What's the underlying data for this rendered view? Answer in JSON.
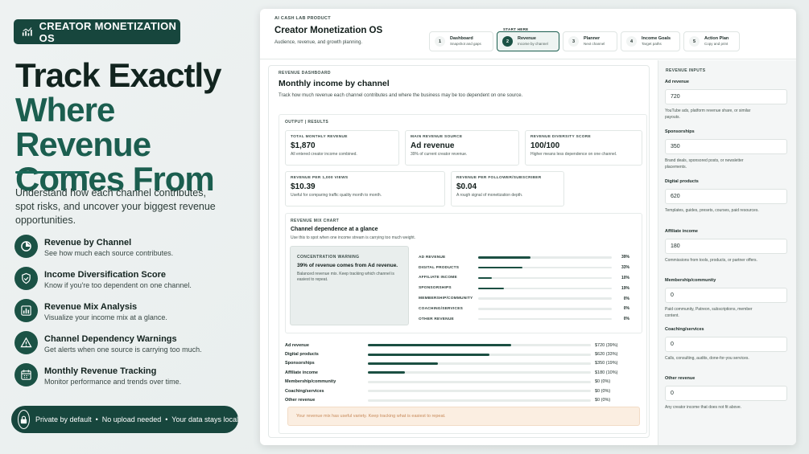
{
  "brand": {
    "label": "CREATOR MONETIZATION OS"
  },
  "hero": {
    "line1": "Track Exactly",
    "line2": "Where Revenue",
    "line3": "Comes From",
    "subtitle": "Understand how each channel contributes, spot risks, and uncover your biggest revenue opportunities."
  },
  "features": [
    {
      "title": "Revenue by Channel",
      "desc": "See how much each source contributes.",
      "icon": "pie-chart-icon"
    },
    {
      "title": "Income Diversification Score",
      "desc": "Know if you're too dependent on one channel.",
      "icon": "shield-check-icon"
    },
    {
      "title": "Revenue Mix Analysis",
      "desc": "Visualize your income mix at a glance.",
      "icon": "bar-chart-icon"
    },
    {
      "title": "Channel Dependency Warnings",
      "desc": "Get alerts when one source is carrying too much.",
      "icon": "warning-icon"
    },
    {
      "title": "Monthly Revenue Tracking",
      "desc": "Monitor performance and trends over time.",
      "icon": "calendar-icon"
    }
  ],
  "privacy": {
    "text": "Private by default  •  No upload needed  •  Your data stays local"
  },
  "app": {
    "kicker": "AI CASH LAB PRODUCT",
    "title": "Creator Monetization OS",
    "subtitle": "Audience, revenue, and growth planning.",
    "start_here": "START HERE",
    "steps": [
      {
        "num": "1",
        "label": "Dashboard",
        "sub": "Snapshot and gaps"
      },
      {
        "num": "2",
        "label": "Revenue",
        "sub": "Income by channel"
      },
      {
        "num": "3",
        "label": "Planner",
        "sub": "Next channel"
      },
      {
        "num": "4",
        "label": "Income Goals",
        "sub": "Target paths"
      },
      {
        "num": "5",
        "label": "Action Plan",
        "sub": "Copy and print"
      }
    ]
  },
  "dashboard": {
    "kicker": "REVENUE DASHBOARD",
    "title": "Monthly income by channel",
    "desc": "Track how much revenue each channel contributes and where the business may be too dependent on one source.",
    "output_kicker": "OUTPUT | RESULTS",
    "cards": [
      {
        "k": "TOTAL MONTHLY REVENUE",
        "v": "$1,870",
        "s": "All entered creator income combined."
      },
      {
        "k": "MAIN REVENUE SOURCE",
        "v": "Ad revenue",
        "s": "39% of current creator revenue."
      },
      {
        "k": "REVENUE DIVERSITY SCORE",
        "v": "100/100",
        "s": "Higher means less dependence on one channel."
      },
      {
        "k": "REVENUE PER 1,000 VIEWS",
        "v": "$10.39",
        "s": "Useful for comparing traffic quality month to month."
      },
      {
        "k": "REVENUE PER FOLLOWER/SUBSCRIBER",
        "v": "$0.04",
        "s": "A rough signal of monetization depth."
      }
    ],
    "mix": {
      "kicker": "REVENUE MIX CHART",
      "title": "Channel dependence at a glance",
      "sub": "Use this to spot when one income stream is carrying too much weight.",
      "warning": {
        "kicker": "CONCENTRATION WARNING",
        "title": "39% of revenue comes from Ad revenue.",
        "desc": "Balanced revenue mix. Keep tracking which channel is easiest to repeat."
      },
      "rows": [
        {
          "label": "AD REVENUE",
          "pct": 39,
          "pct_label": "39%"
        },
        {
          "label": "DIGITAL PRODUCTS",
          "pct": 33,
          "pct_label": "33%"
        },
        {
          "label": "AFFILIATE INCOME",
          "pct": 10,
          "pct_label": "10%"
        },
        {
          "label": "SPONSORSHIPS",
          "pct": 19,
          "pct_label": "19%"
        },
        {
          "label": "MEMBERSHIP/COMMUNITY",
          "pct": 0,
          "pct_label": "0%"
        },
        {
          "label": "COACHING/SERVICES",
          "pct": 0,
          "pct_label": "0%"
        },
        {
          "label": "OTHER REVENUE",
          "pct": 0,
          "pct_label": "0%"
        }
      ]
    },
    "bars": [
      {
        "label": "Ad revenue",
        "pct": 39,
        "value": "$720 (39%)"
      },
      {
        "label": "Digital products",
        "pct": 33,
        "value": "$620 (33%)"
      },
      {
        "label": "Sponsorships",
        "pct": 19,
        "value": "$350 (19%)"
      },
      {
        "label": "Affiliate income",
        "pct": 10,
        "value": "$180 (10%)"
      },
      {
        "label": "Membership/community",
        "pct": 0,
        "value": "$0 (0%)"
      },
      {
        "label": "Coaching/services",
        "pct": 0,
        "value": "$0 (0%)"
      },
      {
        "label": "Other revenue",
        "pct": 0,
        "value": "$0 (0%)"
      }
    ],
    "note": "Your revenue mix has useful variety. Keep tracking what is easiest to repeat."
  },
  "inputs": {
    "kicker": "REVENUE INPUTS",
    "fields": [
      {
        "label": "Ad revenue",
        "value": "720",
        "help": "YouTube ads, platform revenue share, or similar payouts."
      },
      {
        "label": "Sponsorships",
        "value": "350",
        "help": "Brand deals, sponsored posts, or newsletter placements."
      },
      {
        "label": "Digital products",
        "value": "620",
        "help": "Templates, guides, presets, courses, paid resources."
      },
      {
        "label": "Affiliate income",
        "value": "180",
        "help": "Commissions from tools, products, or partner offers."
      },
      {
        "label": "Membership/community",
        "value": "0",
        "help": "Paid community, Patreon, subscriptions, member content."
      },
      {
        "label": "Coaching/services",
        "value": "0",
        "help": "Calls, consulting, audits, done-for-you services."
      },
      {
        "label": "Other revenue",
        "value": "0",
        "help": "Any creator income that does not fit above."
      }
    ]
  }
}
